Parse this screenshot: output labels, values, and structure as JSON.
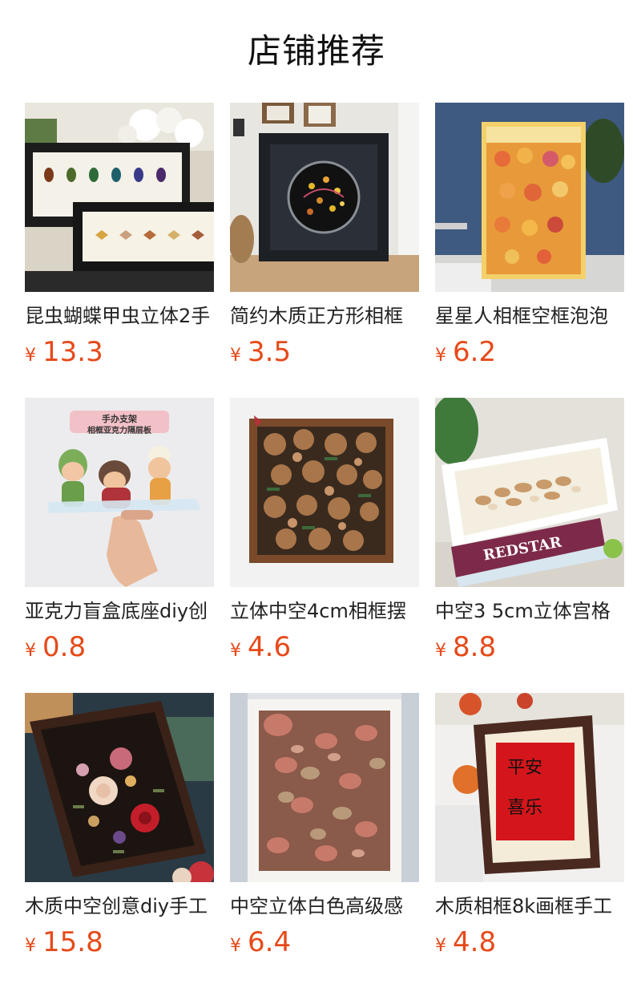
{
  "header": {
    "title": "店铺推荐"
  },
  "currency_symbol": "¥",
  "price_color": "#e64a19",
  "products": [
    {
      "name": "昆虫蝴蝶甲虫立体2手",
      "price": "13.3",
      "image": "insect-frame-image"
    },
    {
      "name": "简约木质正方形相框",
      "price": "3.5",
      "image": "square-frame-image"
    },
    {
      "name": "星星人相框空框泡泡",
      "price": "6.2",
      "image": "star-figure-lightbox-image"
    },
    {
      "name": "亚克力盲盒底座diy创",
      "price": "0.8",
      "image": "acrylic-shelf-image",
      "image_text": [
        "手办支架",
        "相框亚克力隔层板"
      ]
    },
    {
      "name": "立体中空4cm相框摆",
      "price": "4.6",
      "image": "pinecone-frame-image"
    },
    {
      "name": "中空3 5cm立体宫格",
      "price": "8.8",
      "image": "seashell-frame-image",
      "image_text": [
        "REDSTAR"
      ]
    },
    {
      "name": "木质中空创意diy手工",
      "price": "15.8",
      "image": "dried-flower-frame-image"
    },
    {
      "name": "中空立体白色高级感",
      "price": "6.4",
      "image": "petal-frame-image"
    },
    {
      "name": "木质相框8k画框手工",
      "price": "4.8",
      "image": "calligraphy-frame-image",
      "image_text": [
        "平安喜乐"
      ]
    }
  ]
}
